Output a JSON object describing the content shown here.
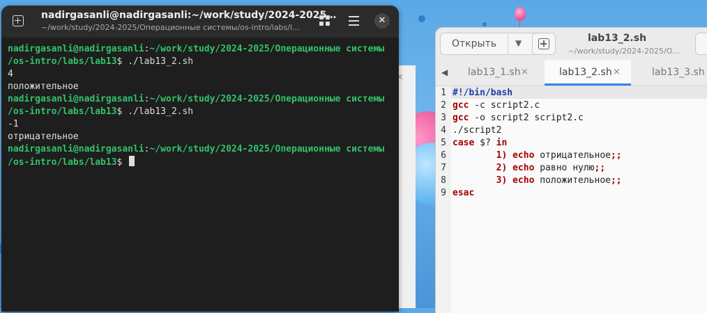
{
  "terminal": {
    "title": "nadirgasanli@nadirgasanli:~/work/study/2024-2025…",
    "subtitle": "~/work/study/2024-2025/Операционные системы/os-intro/labs/l…",
    "lines": [
      {
        "type": "prompt",
        "user": "nadirgasanli@nadirgasanli",
        "colon": ":",
        "path": "~/work/study/2024-2025/Операционные системы"
      },
      {
        "type": "prompt2",
        "path": "/os-intro/labs/lab13",
        "sym": "$ ",
        "cmd": "./lab13_2.sh"
      },
      {
        "type": "out",
        "text": "4"
      },
      {
        "type": "out",
        "text": "положительное"
      },
      {
        "type": "prompt",
        "user": "nadirgasanli@nadirgasanli",
        "colon": ":",
        "path": "~/work/study/2024-2025/Операционные системы"
      },
      {
        "type": "prompt2",
        "path": "/os-intro/labs/lab13",
        "sym": "$ ",
        "cmd": "./lab13_2.sh"
      },
      {
        "type": "out",
        "text": "-1"
      },
      {
        "type": "out",
        "text": "отрицательное"
      },
      {
        "type": "prompt",
        "user": "nadirgasanli@nadirgasanli",
        "colon": ":",
        "path": "~/work/study/2024-2025/Операционные системы"
      },
      {
        "type": "prompt2cur",
        "path": "/os-intro/labs/lab13",
        "sym": "$ ",
        "cmd": ""
      }
    ]
  },
  "editor": {
    "open_label": "Открыть",
    "title": "lab13_2.sh",
    "subtitle": "~/work/study/2024-2025/О…",
    "tabs": [
      {
        "label": "lab13_1.sh",
        "close": "×"
      },
      {
        "label": "lab13_2.sh",
        "close": "×"
      },
      {
        "label": "lab13_3.sh"
      }
    ],
    "code": [
      {
        "n": "1",
        "parts": [
          [
            "#!/bin/bash",
            "k-blue"
          ]
        ]
      },
      {
        "n": "2",
        "parts": [
          [
            "gcc",
            "k-red"
          ],
          [
            " -c script2.c",
            "k-normal"
          ]
        ]
      },
      {
        "n": "3",
        "parts": [
          [
            "gcc",
            "k-red"
          ],
          [
            " -o script2 script2.c",
            "k-normal"
          ]
        ]
      },
      {
        "n": "4",
        "parts": [
          [
            "./script2",
            "k-normal"
          ]
        ]
      },
      {
        "n": "5",
        "parts": [
          [
            "case",
            "k-red"
          ],
          [
            " $? ",
            "k-normal"
          ],
          [
            "in",
            "k-red"
          ]
        ]
      },
      {
        "n": "6",
        "parts": [
          [
            "        1) ",
            "k-red"
          ],
          [
            "echo",
            "k-red"
          ],
          [
            " отрицательное",
            "k-normal"
          ],
          [
            ";;",
            "k-red"
          ]
        ]
      },
      {
        "n": "7",
        "parts": [
          [
            "        2) ",
            "k-red"
          ],
          [
            "echo",
            "k-red"
          ],
          [
            " равно нулю",
            "k-normal"
          ],
          [
            ";;",
            "k-red"
          ]
        ]
      },
      {
        "n": "8",
        "parts": [
          [
            "        3) ",
            "k-red"
          ],
          [
            "echo",
            "k-red"
          ],
          [
            " положительное",
            "k-normal"
          ],
          [
            ";;",
            "k-red"
          ]
        ]
      },
      {
        "n": "9",
        "parts": [
          [
            "esac",
            "k-red"
          ]
        ]
      }
    ]
  }
}
